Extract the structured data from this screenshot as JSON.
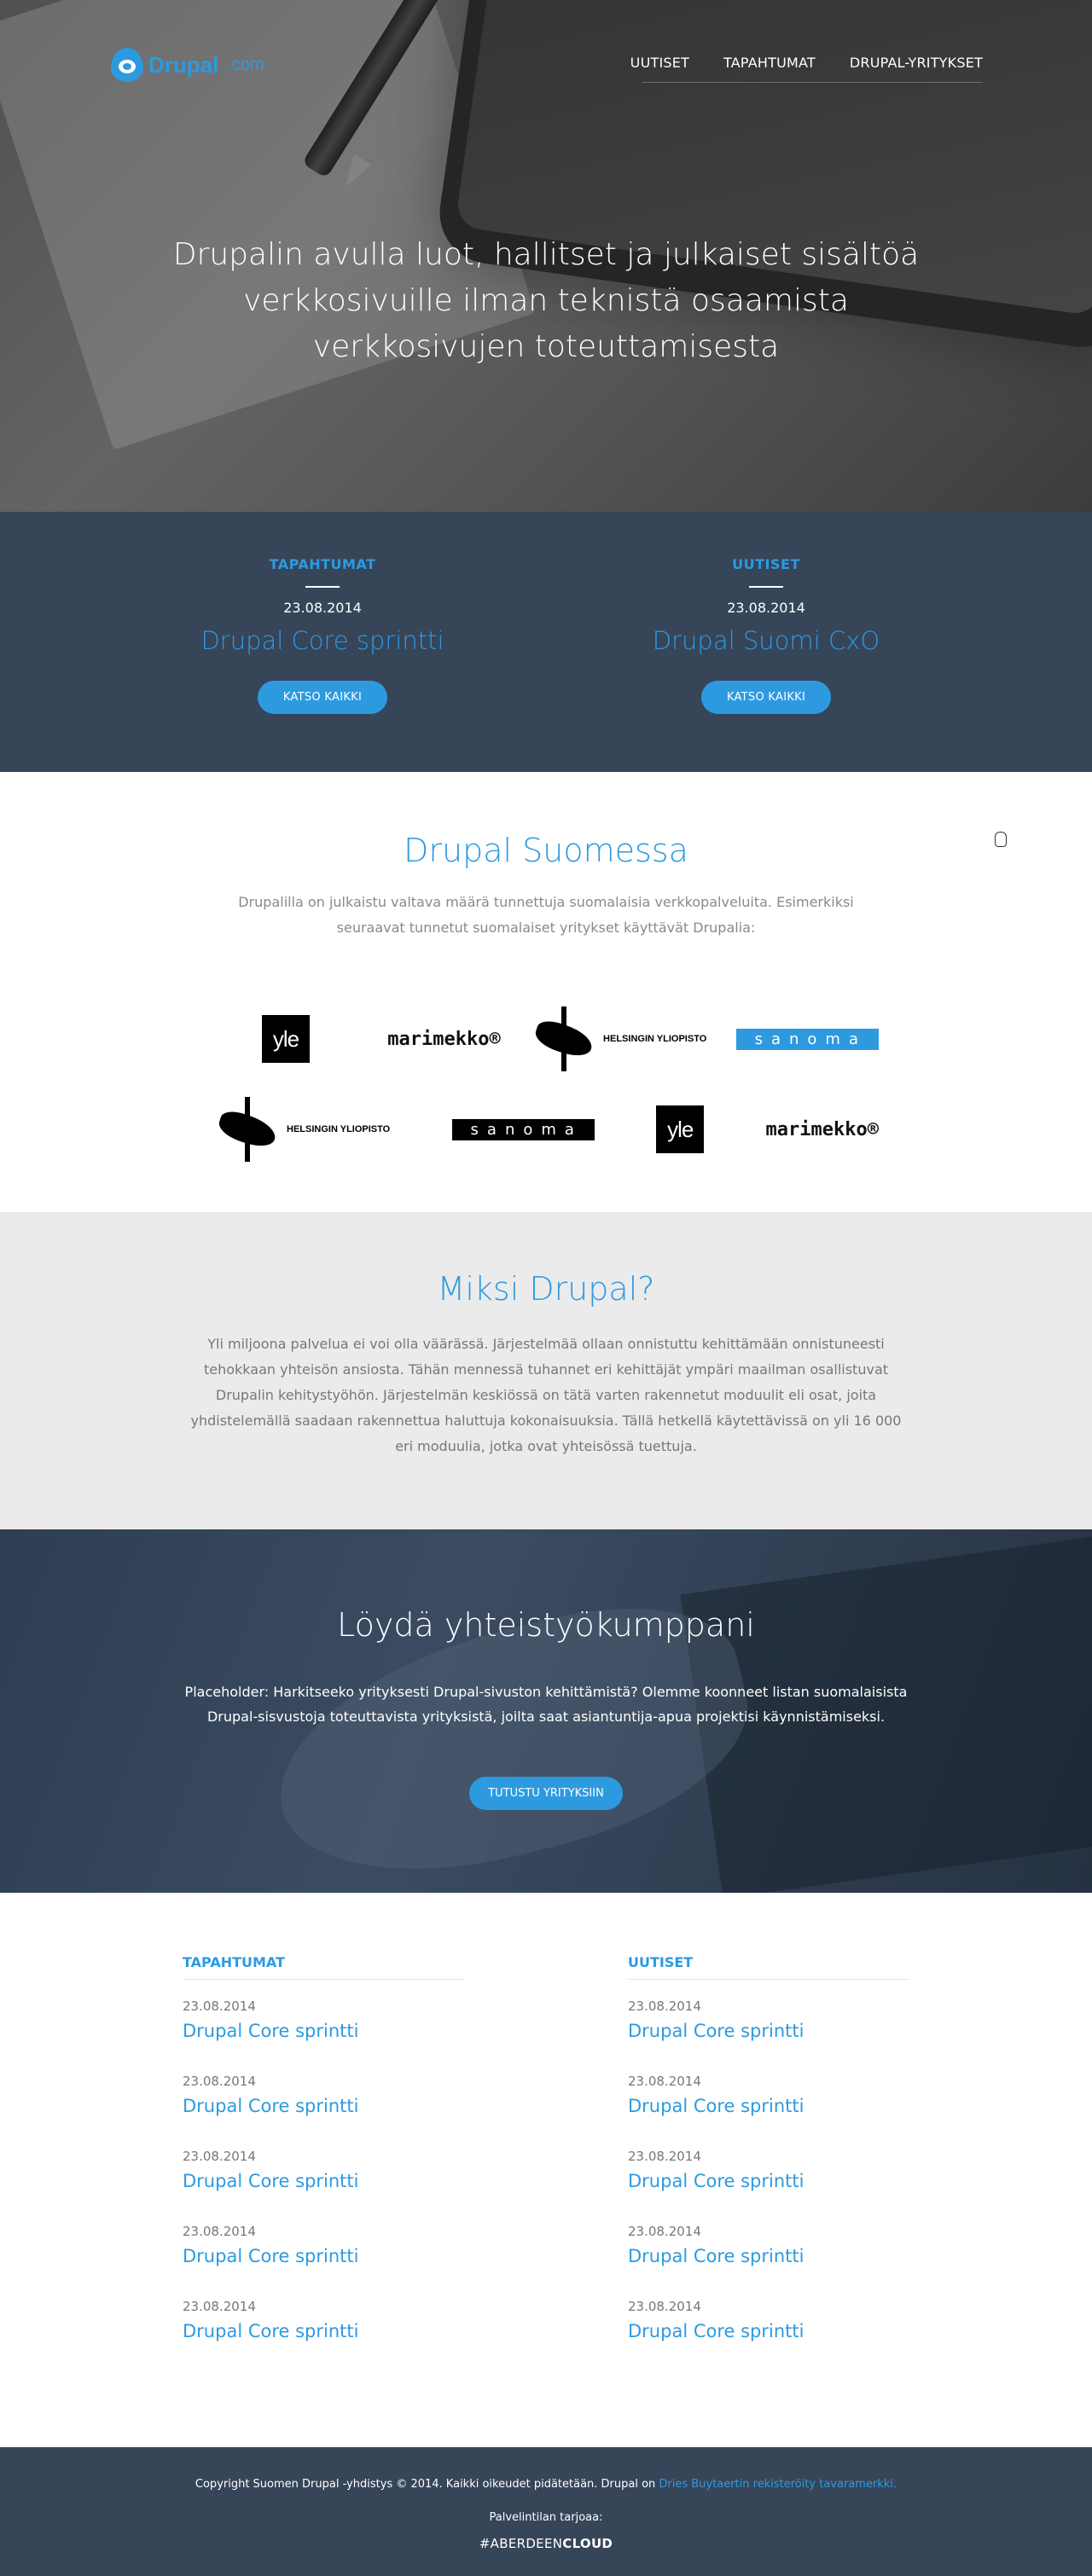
{
  "header": {
    "logo_text": "Drupal",
    "logo_sub": ".com",
    "nav": [
      "UUTISET",
      "TAPAHTUMAT",
      "DRUPAL-YRITYKSET"
    ]
  },
  "hero": {
    "title": "Drupalin avulla luot, hallitset ja julkaiset sisältöä verkkosivuille ilman teknistä osaamista verkkosivujen toteuttamisesta"
  },
  "strip": {
    "events": {
      "category": "TAPAHTUMAT",
      "date": "23.08.2014",
      "title": "Drupal Core sprintti",
      "button": "KATSO KAIKKI"
    },
    "news": {
      "category": "UUTISET",
      "date": "23.08.2014",
      "title": "Drupal Suomi CxO",
      "button": "KATSO KAIKKI"
    }
  },
  "finland": {
    "title": "Drupal Suomessa",
    "text": "Drupalilla on julkaistu valtava määrä tunnettuja suomalaisia verkkopalveluita. Esimerkiksi seuraavat tunnetut suomalaiset yritykset käyttävät Drupalia:",
    "logos": {
      "yle": "yle",
      "marimekko": "marimekko®",
      "hy": "HELSINGIN YLIOPISTO",
      "sanoma": "sanoma"
    }
  },
  "why": {
    "title": "Miksi Drupal?",
    "text": "Yli miljoona palvelua ei voi olla väärässä. Järjestelmää ollaan onnistuttu kehittämään onnistuneesti tehokkaan yhteisön ansiosta. Tähän mennessä tuhannet eri kehittäjät ympäri maailman osallistuvat Drupalin kehitystyöhön. Järjestelmän keskiössä on tätä varten rakennetut moduulit eli osat, joita yhdistelemällä saadaan rakennettua haluttuja kokonaisuuksia. Tällä hetkellä käytettävissä on yli 16 000 eri moduulia, jotka ovat yhteisössä tuettuja."
  },
  "partner": {
    "title": "Löydä yhteistyökumppani",
    "text": "Placeholder: Harkitseeko yrityksesti Drupal-sivuston kehittämistä? Olemme koonneet listan suomalaisista Drupal-sisvustoja toteuttavista yrityksistä, joilta saat asiantuntija-apua projektisi käynnistämiseksi.",
    "button": "TUTUSTU YRITYKSIIN"
  },
  "lists": {
    "events": {
      "heading": "TAPAHTUMAT",
      "items": [
        {
          "date": "23.08.2014",
          "title": "Drupal Core sprintti"
        },
        {
          "date": "23.08.2014",
          "title": "Drupal Core sprintti"
        },
        {
          "date": "23.08.2014",
          "title": "Drupal Core sprintti"
        },
        {
          "date": "23.08.2014",
          "title": "Drupal Core sprintti"
        },
        {
          "date": "23.08.2014",
          "title": "Drupal Core sprintti"
        }
      ]
    },
    "news": {
      "heading": "UUTISET",
      "items": [
        {
          "date": "23.08.2014",
          "title": "Drupal Core sprintti"
        },
        {
          "date": "23.08.2014",
          "title": "Drupal Core sprintti"
        },
        {
          "date": "23.08.2014",
          "title": "Drupal Core sprintti"
        },
        {
          "date": "23.08.2014",
          "title": "Drupal Core sprintti"
        },
        {
          "date": "23.08.2014",
          "title": "Drupal Core sprintti"
        }
      ]
    }
  },
  "footer": {
    "copyright": "Copyright Suomen Drupal -yhdistys © 2014. Kaikki oikeudet pidätetään. Drupal on ",
    "trademark_link": "Dries Buytaertin rekisteröity tavaramerkki.",
    "hosting": "Palvelintilan tarjoaa:",
    "brand_prefix": "#ABERDEEN",
    "brand_suffix": "CLOUD"
  },
  "colors": {
    "accent": "#2d9ae0",
    "dark_band": "#374559",
    "light_band": "#ebebeb"
  }
}
